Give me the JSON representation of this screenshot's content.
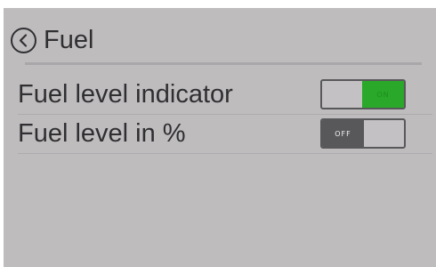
{
  "header": {
    "back_icon": "chevron-left-circle-icon",
    "title": "Fuel"
  },
  "settings": [
    {
      "label": "Fuel level indicator",
      "toggle_state": "ON",
      "enabled": true
    },
    {
      "label": "Fuel level in %",
      "toggle_state": "OFF",
      "enabled": false
    }
  ],
  "colors": {
    "background": "#bfbcbe",
    "toggle_on": "#29a829",
    "toggle_off": "#58585a",
    "text": "#2f2f31"
  }
}
